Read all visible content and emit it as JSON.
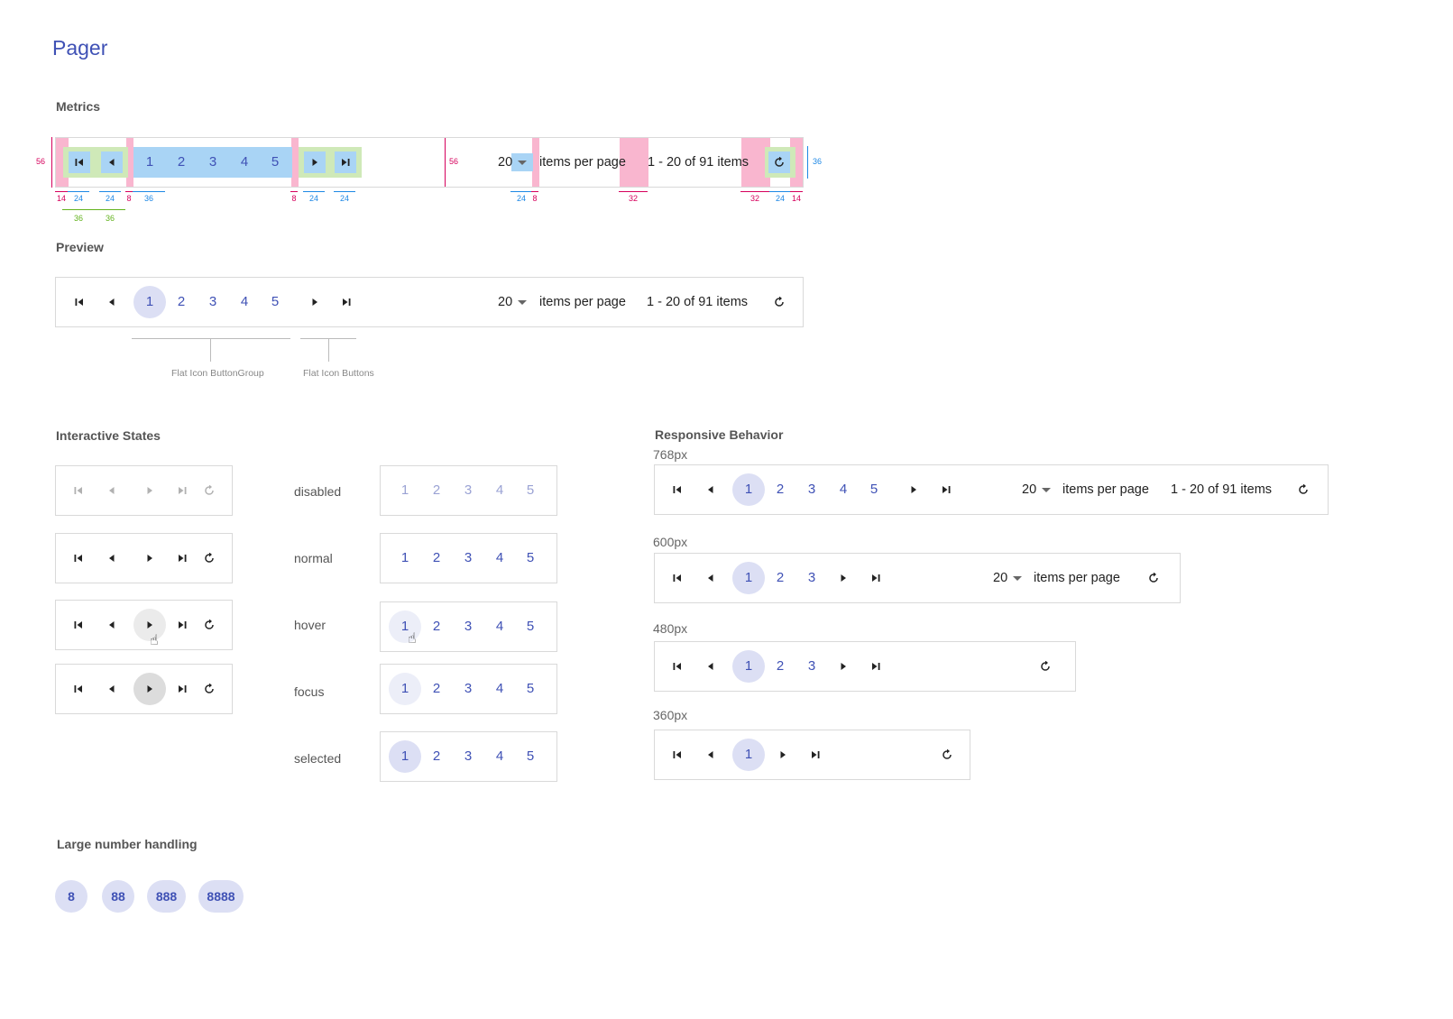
{
  "page_title": "Pager",
  "sections": {
    "metrics": "Metrics",
    "preview": "Preview",
    "interactive_states": "Interactive States",
    "responsive": "Responsive Behavior",
    "large_numbers": "Large number handling"
  },
  "pager": {
    "pages": [
      "1",
      "2",
      "3",
      "4",
      "5"
    ],
    "page_size": "20",
    "items_per_page_label": "items per page",
    "range_label": "1 - 20 of 91 items"
  },
  "metrics": {
    "height_left": "56",
    "height_mid": "56",
    "height_right": "36",
    "dims": {
      "d14a": "14",
      "d24a": "24",
      "d24b": "24",
      "d8a": "8",
      "d36a": "36",
      "d36g1": "36",
      "d36g2": "36",
      "d8b": "8",
      "d24c": "24",
      "d24d": "24",
      "d24e": "24",
      "d8c": "8",
      "d32a": "32",
      "d32b": "32",
      "d24f": "24",
      "d14b": "14"
    }
  },
  "captions": {
    "group": "Flat Icon ButtonGroup",
    "buttons": "Flat Icon Buttons"
  },
  "states": [
    "disabled",
    "normal",
    "hover",
    "focus",
    "selected"
  ],
  "responsive": {
    "w768": "768px",
    "w600": "600px",
    "w480": "480px",
    "w360": "360px"
  },
  "large_numbers": [
    "8",
    "88",
    "888",
    "8888"
  ],
  "colors": {
    "accent": "#3f51b5",
    "selected_bg": "#dcdff4",
    "metric_pink": "#f9b6cf",
    "metric_green": "#cfe9b8",
    "metric_blue": "#a9d4f5"
  },
  "icons": [
    "first-page-icon",
    "prev-page-icon",
    "next-page-icon",
    "last-page-icon",
    "refresh-icon",
    "dropdown-caret-icon",
    "hand-cursor-icon"
  ]
}
